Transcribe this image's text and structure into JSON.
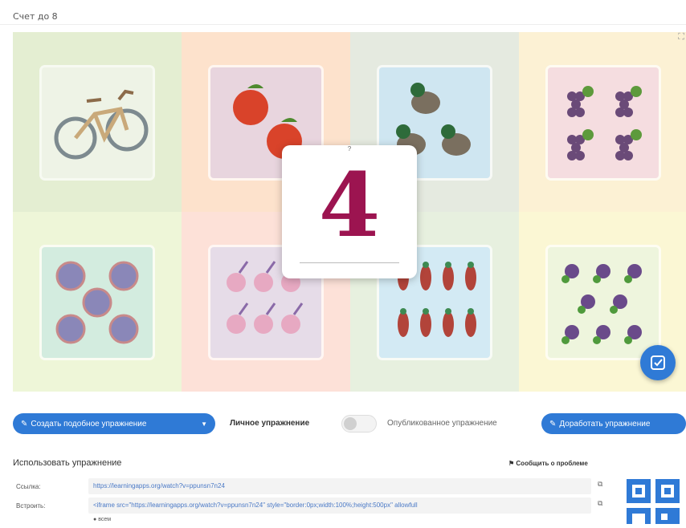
{
  "app": {
    "title": "Счет до 8"
  },
  "board": {
    "expand_icon": "fullscreen-icon",
    "cards": [
      {
        "name": "bicycle",
        "cell_color": "#e4eed2",
        "card_color": "#eef3e6",
        "icon": "bicycle-icon"
      },
      {
        "name": "apples",
        "cell_color": "#fde2cc",
        "card_color": "#e8d5de",
        "icon": "apple-icon"
      },
      {
        "name": "ducks",
        "cell_color": "#e5eae0",
        "card_color": "#cfe6f1",
        "icon": "duck-icon"
      },
      {
        "name": "grapes",
        "cell_color": "#fcf1d4",
        "card_color": "#f5dde0",
        "icon": "grape-icon"
      },
      {
        "name": "balls",
        "cell_color": "#eef6d8",
        "card_color": "#d3ecdf",
        "icon": "ball-icon"
      },
      {
        "name": "ice-creams",
        "cell_color": "#fde1d8",
        "card_color": "#e6dce8",
        "icon": "ice-cream-icon"
      },
      {
        "name": "parrots",
        "cell_color": "#e7f0df",
        "card_color": "#d3eaf4",
        "icon": "parrot-icon"
      },
      {
        "name": "flowers",
        "cell_color": "#fbf7d4",
        "card_color": "#eef5dd",
        "icon": "flower-icon"
      }
    ]
  },
  "overlay": {
    "question_mark": "?",
    "number": "4"
  },
  "toolbar": {
    "create_similar": "Создать подобное упражнение",
    "private_label": "Личное упражнение",
    "published_label": "Опубликованное упражнение",
    "refine": "Доработать упражнение"
  },
  "use": {
    "heading": "Использовать упражнение",
    "report": "Сообщить о проблеме",
    "link_label": "Ссылка:",
    "link_value": "https://learningapps.org/watch?v=ppunsn7n24",
    "embed_label": "Встроить:",
    "embed_value": "<iframe src=\"https://learningapps.org/watch?v=ppunsn7n24\" style=\"border:0px;width:100%;height:500px\" allowfull",
    "access_label": "всем"
  },
  "colors": {
    "accent": "#2f7ad6",
    "number": "#9c1450"
  }
}
